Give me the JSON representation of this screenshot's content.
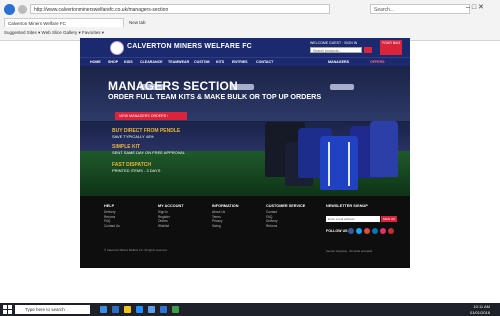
{
  "browser": {
    "address": "http://www.calvertonminerswelfarefc.co.uk/managers-section",
    "search_placeholder": "Search...",
    "win_controls": "–  □  ✕",
    "tabs": [
      {
        "label": "Calverton Miners Welfare FC"
      },
      {
        "label": "New tab"
      }
    ],
    "favorites": "Suggested Sites  ▾   Web Slice Gallery  ▾   Favorites  ▾"
  },
  "site": {
    "title": "CALVERTON MINERS WELFARE FC",
    "login_text": "WELCOME GUEST · SIGN IN",
    "search_placeholder": "Search products...",
    "bag_label": "YOUR BAG",
    "nav": [
      "HOME",
      "SHOP",
      "KIDS",
      "CLEARANCE",
      "TEAMWEAR",
      "CUSTOM",
      "KITS",
      "ENTRIES",
      "CONTACT",
      "MANAGERS",
      "OFFERS"
    ]
  },
  "hero": {
    "title": "MANAGERS SECTION",
    "subtitle": "ORDER FULL TEAM KITS & MAKE BULK OR TOP UP ORDERS",
    "cta": "VIEW MANAGERS ORDERS ›",
    "features": [
      {
        "title": "BUY DIRECT FROM PENDLE",
        "sub": "SAVE TYPICALLY 40%"
      },
      {
        "title": "SIMPLE KIT",
        "sub": "SENT SAME DAY ON FREE APPROVAL"
      },
      {
        "title": "FAST DISPATCH",
        "sub": "PRINTED ITEMS - 3 DAYS"
      }
    ]
  },
  "footer": {
    "columns": [
      {
        "head": "HELP",
        "links": [
          "Delivery",
          "Returns",
          "FAQ",
          "Contact Us"
        ]
      },
      {
        "head": "MY ACCOUNT",
        "links": [
          "Sign In",
          "Register",
          "Orders",
          "Wishlist"
        ]
      },
      {
        "head": "INFORMATION",
        "links": [
          "About Us",
          "Terms",
          "Privacy",
          "Sizing"
        ]
      },
      {
        "head": "CUSTOMER SERVICE",
        "links": [
          "Contact",
          "FAQ",
          "Delivery",
          "Returns"
        ]
      }
    ],
    "newsletter_head": "NEWSLETTER SIGNUP",
    "newsletter_placeholder": "Enter email address",
    "newsletter_btn": "SIGN UP",
    "follow_label": "FOLLOW US",
    "social_colors": [
      "#3b5998",
      "#1da1f2",
      "#dd4b39",
      "#0077b5",
      "#e1306c",
      "#c4302b"
    ],
    "copyright": "© Calverton Miners Welfare FC. All rights reserved.",
    "copyright_right": "Secure shopping · All cards accepted"
  },
  "taskbar": {
    "search_placeholder": "Type here to search",
    "time": "10:11 AM",
    "date": "01/01/2018"
  }
}
